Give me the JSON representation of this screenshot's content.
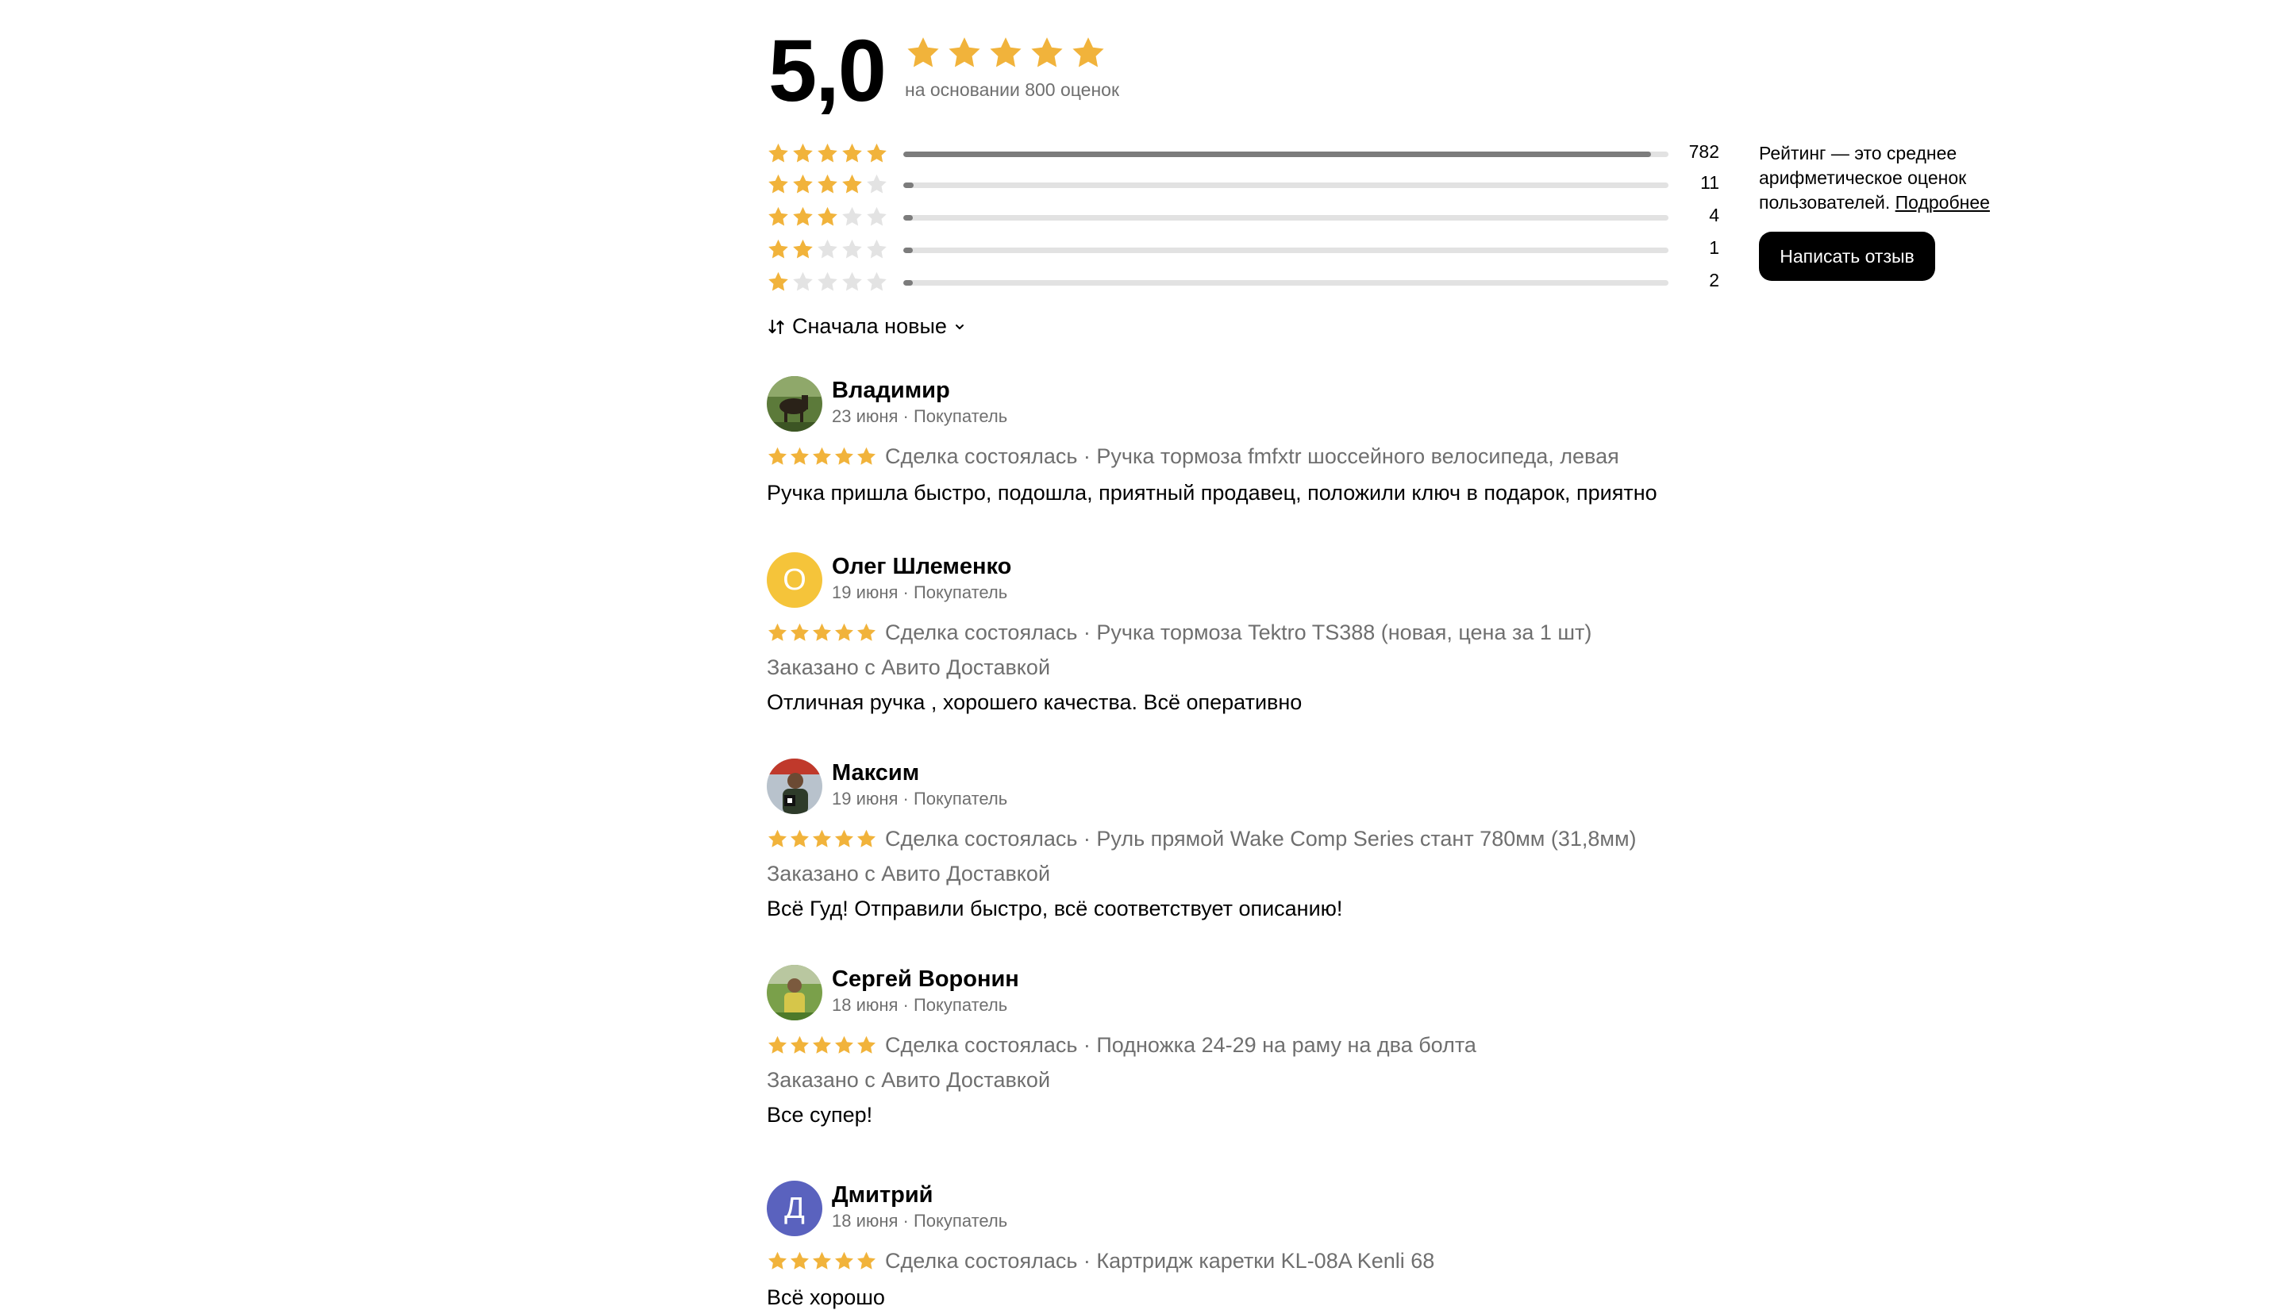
{
  "summary": {
    "score": "5,0",
    "stars": 5,
    "basis": "на основании 800 оценок"
  },
  "distribution": [
    {
      "stars": 5,
      "count": "782",
      "fraction": 0.977
    },
    {
      "stars": 4,
      "count": "11",
      "fraction": 0.014
    },
    {
      "stars": 3,
      "count": "4",
      "fraction": 0.005
    },
    {
      "stars": 2,
      "count": "1",
      "fraction": 0.001
    },
    {
      "stars": 1,
      "count": "2",
      "fraction": 0.003
    }
  ],
  "info": {
    "text": "Рейтинг — это среднее арифметическое оценок пользователей.",
    "link": "Подробнее"
  },
  "write_review_label": "Написать отзыв",
  "sort_label": "Сначала новые",
  "reviews": [
    {
      "name": "Владимир",
      "meta": "23 июня · Покупатель",
      "avatar": "photo-horse",
      "rating": 5,
      "deal": "Сделка состоялась · Ручка тормоза fmfxtr шоссейного велосипеда, левая",
      "delivery": "",
      "text": "Ручка пришла быстро, подошла, приятный продавец, положили ключ в подарок, приятно"
    },
    {
      "name": "Олег Шлеменко",
      "meta": "19 июня · Покупатель",
      "avatar_letter": "О",
      "avatar_color": "#f5c43a",
      "rating": 5,
      "deal": "Сделка состоялась · Ручка тормоза Tektro TS388 (новая, цена за 1 шт)",
      "delivery": "Заказано с Авито Доставкой",
      "text": "Отличная ручка , хорошего качества. Всё оперативно"
    },
    {
      "name": "Максим",
      "meta": "19 июня · Покупатель",
      "avatar": "photo-man-flag",
      "rating": 5,
      "deal": "Сделка состоялась · Руль прямой Wake Comp Series стант 780мм (31,8мм)",
      "delivery": "Заказано с Авито Доставкой",
      "text": "Всё Гуд! Отправили быстро, всё соответствует описанию!"
    },
    {
      "name": "Сергей Воронин",
      "meta": "18 июня · Покупатель",
      "avatar": "photo-man-field",
      "rating": 5,
      "deal": "Сделка состоялась · Подножка 24-29 на раму на два болта",
      "delivery": "Заказано с Авито Доставкой",
      "text": "Все супер!"
    },
    {
      "name": "Дмитрий",
      "meta": "18 июня · Покупатель",
      "avatar_letter": "Д",
      "avatar_color": "#5a62be",
      "rating": 5,
      "deal": "Сделка состоялась · Картридж каретки KL-08A Kenli 68",
      "delivery": "",
      "text": "Всё хорошо"
    }
  ],
  "colors": {
    "star_filled": "#f1b33b",
    "star_empty": "#e3e3e3",
    "bar_fill": "#7c7c7c",
    "bar_track": "#e2e2e2",
    "button_bg": "#000000",
    "muted_text": "#6f6f6f"
  }
}
